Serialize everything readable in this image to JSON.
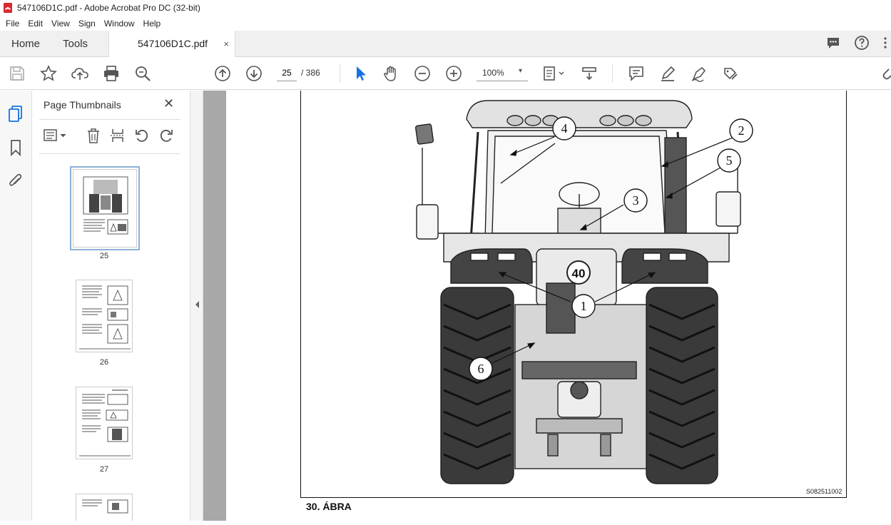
{
  "window": {
    "title": "547106D1C.pdf - Adobe Acrobat Pro DC (32-bit)"
  },
  "menu": [
    "File",
    "Edit",
    "View",
    "Sign",
    "Window",
    "Help"
  ],
  "tabs": {
    "home": "Home",
    "tools": "Tools",
    "document": "547106D1C.pdf",
    "close": "×"
  },
  "navigation": {
    "current_page": "25",
    "total_pages": "/ 386",
    "zoom": "100%"
  },
  "thumbnails_panel": {
    "title": "Page Thumbnails",
    "close": "✕",
    "pages": [
      {
        "label": "25",
        "selected": true
      },
      {
        "label": "26",
        "selected": false
      },
      {
        "label": "27",
        "selected": false
      }
    ]
  },
  "document": {
    "figure_code": "S082511002",
    "caption": "30. ÁBRA",
    "callouts": [
      "1",
      "2",
      "3",
      "4",
      "5",
      "6"
    ],
    "speed_sign": "40"
  },
  "colors": {
    "accent": "#1473e6",
    "viewer_bg": "#a8a8a8",
    "pdf_red": "#d9272e"
  }
}
